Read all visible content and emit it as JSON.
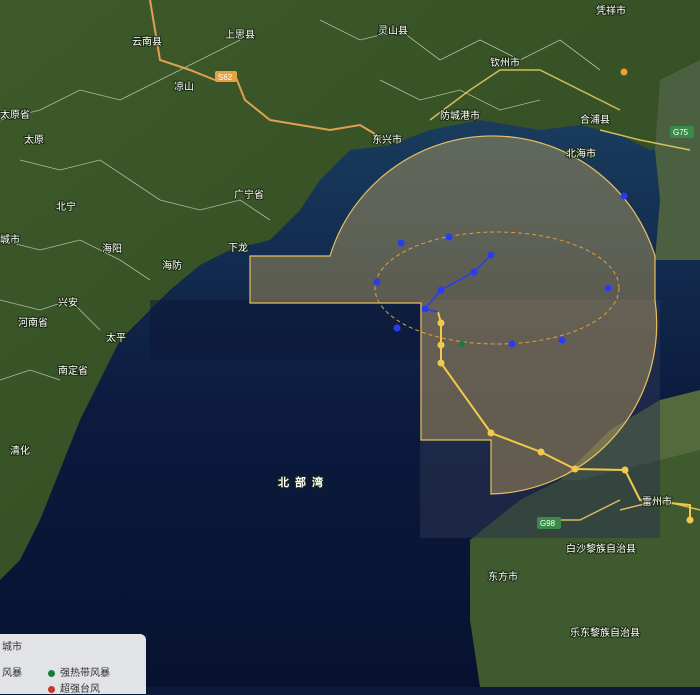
{
  "map": {
    "labels": {
      "yunan": "云南县",
      "shangsi": "上思县",
      "lingshan": "灵山县",
      "qinzhou": "钦州市",
      "taiyuan_prov": "太原省",
      "taiyuan": "太原",
      "liangshan": "凉山",
      "fangchenggang": "防城港市",
      "dongxing": "东兴市",
      "pubei": "合浦县",
      "beihai": "北海市",
      "guangning_prov": "广宁省",
      "beining": "北宁",
      "xialong": "下龙",
      "haiyang": "海阳",
      "haifang": "海防",
      "xingan": "兴安",
      "henan_prov": "河南省",
      "taiping": "太平",
      "nanding_prov": "南定省",
      "qinghua": "清化",
      "beibuwan": "北部湾",
      "leizhou": "雷州市",
      "haikou_city": "城市",
      "baisha": "白沙黎族自治县",
      "ledong": "乐东黎族自治县",
      "dongfang": "东方市",
      "ningyuan": "凭祥市",
      "city_left_bottom": "城市"
    },
    "road_shields": {
      "s62": "S62",
      "g75": "G75",
      "g98": "G98"
    },
    "forecast_radius_color": "#e8c060",
    "track_color_past": "#f2c94c",
    "track_color_forecast": "#2a3cf0",
    "intensity_colors": {
      "strong_tropical_storm": "#1a7a3c",
      "super_typhoon": "#c0392b"
    }
  },
  "legend": {
    "items": [
      {
        "label": "风暴",
        "color": "#f2c94c"
      },
      {
        "label": "强热带风暴",
        "color": "#1a7a3c"
      },
      {
        "label": "超强台风",
        "color": "#c0392b"
      }
    ],
    "header_text": "城市"
  }
}
